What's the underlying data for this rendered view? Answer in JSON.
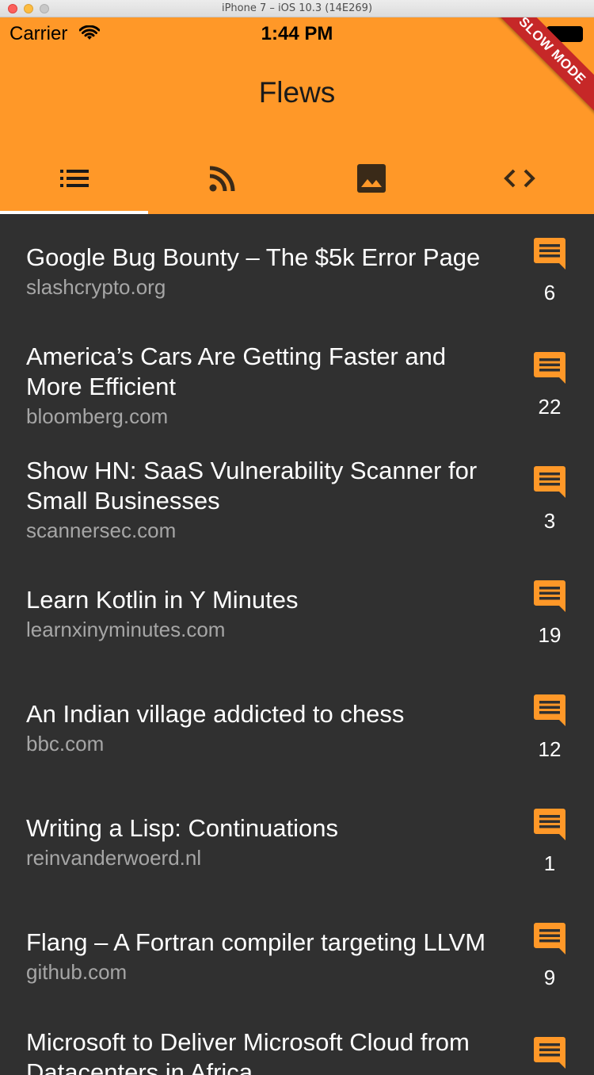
{
  "window": {
    "title": "iPhone 7 – iOS 10.3 (14E269)"
  },
  "statusbar": {
    "carrier": "Carrier",
    "time": "1:44 PM"
  },
  "appbar": {
    "title": "Flews",
    "debug_banner": "SLOW MODE"
  },
  "colors": {
    "accent": "#ff9828",
    "background": "#303030",
    "ribbon": "#c62828",
    "domain_text": "#a6a6a6"
  },
  "tabs": [
    {
      "icon": "list-icon",
      "selected": true
    },
    {
      "icon": "rss-feed-icon",
      "selected": false
    },
    {
      "icon": "image-icon",
      "selected": false
    },
    {
      "icon": "code-icon",
      "selected": false
    }
  ],
  "stories": [
    {
      "title": "Google Bug Bounty – The $5k Error Page",
      "domain": "slashcrypto.org",
      "comments": "6",
      "icon": "comment-icon"
    },
    {
      "title": "America’s Cars Are Getting Faster and More Efficient",
      "domain": "bloomberg.com",
      "comments": "22",
      "icon": "comment-icon"
    },
    {
      "title": "Show HN: SaaS Vulnerability Scanner for Small Businesses",
      "domain": "scannersec.com",
      "comments": "3",
      "icon": "comment-icon"
    },
    {
      "title": "Learn Kotlin in Y Minutes",
      "domain": "learnxinyminutes.com",
      "comments": "19",
      "icon": "comment-icon"
    },
    {
      "title": "An Indian village addicted to chess",
      "domain": "bbc.com",
      "comments": "12",
      "icon": "comment-icon"
    },
    {
      "title": "Writing a Lisp: Continuations",
      "domain": "reinvanderwoerd.nl",
      "comments": "1",
      "icon": "comment-icon"
    },
    {
      "title": "Flang – A Fortran compiler targeting LLVM",
      "domain": "github.com",
      "comments": "9",
      "icon": "comment-icon"
    },
    {
      "title": "Microsoft to Deliver Microsoft Cloud from Datacenters in Africa",
      "domain": "",
      "comments": "",
      "icon": "comment-icon"
    }
  ]
}
